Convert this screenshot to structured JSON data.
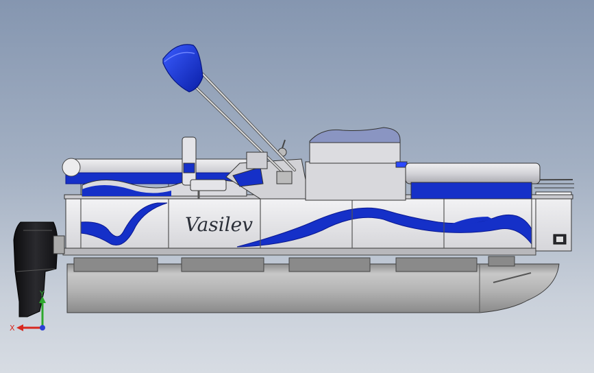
{
  "viewport": {
    "background_top": "#8596b0",
    "background_bottom": "#d7dce3"
  },
  "model": {
    "brand_text": "Vasilev",
    "hull_blue": "#1530c8",
    "pontoon_gray": "#a9a9a9",
    "panel_white": "#e8e8ea"
  },
  "triad": {
    "x_label": "X",
    "y_label": "Y",
    "x_color": "#d8281e",
    "y_color": "#2ea82e",
    "z_color": "#2a3fd6",
    "icon": "coordinate-triad-icon"
  }
}
